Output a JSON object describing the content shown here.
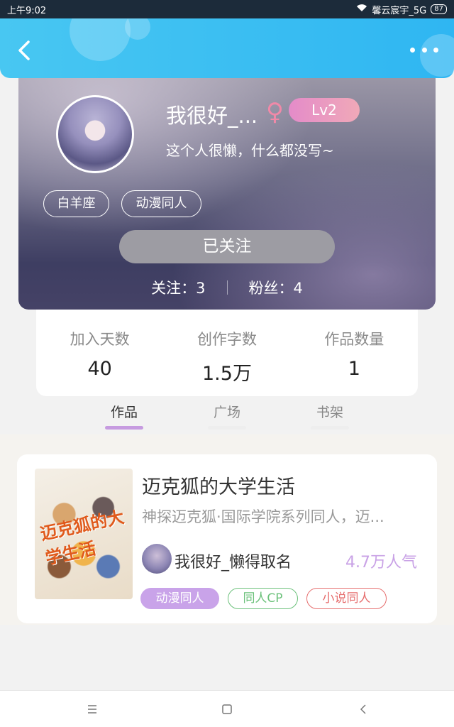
{
  "status_bar": {
    "time": "上午9:02",
    "carrier": "馨云宸宇_5G",
    "battery": "87"
  },
  "header": {
    "back_icon": "back-arrow-icon",
    "more_icon": "more-dots-icon",
    "accent": "#2fb6f2"
  },
  "profile": {
    "username": "我很好_...",
    "gender_symbol": "♀",
    "level": "Lv2",
    "bio": "这个人很懒，什么都没写~",
    "tags": [
      "白羊座",
      "动漫同人"
    ],
    "follow_button": "已关注",
    "following_label": "关注：3",
    "fans_label": "粉丝：4"
  },
  "stats": [
    {
      "label": "加入天数",
      "value": "40"
    },
    {
      "label": "创作字数",
      "value": "1.5万"
    },
    {
      "label": "作品数量",
      "value": "1"
    }
  ],
  "tabs": [
    {
      "label": "作品",
      "active": true
    },
    {
      "label": "广场",
      "active": false
    },
    {
      "label": "书架",
      "active": false
    }
  ],
  "work": {
    "cover_title": "迈克狐的大学生活",
    "title": "迈克狐的大学生活",
    "description": "神探迈克狐·国际学院系列同人，迈...",
    "author": "我很好_懒得取名",
    "popularity": "4.7万人气",
    "tags": [
      {
        "label": "动漫同人",
        "color": "#c9a3e9"
      },
      {
        "label": "同人CP",
        "color": "#6cc17b"
      },
      {
        "label": "小说同人",
        "color": "#e66e6e"
      }
    ]
  },
  "bottom_nav": {
    "menu_icon": "menu-icon",
    "home_icon": "home-square-icon",
    "back_icon": "back-triangle-icon"
  }
}
